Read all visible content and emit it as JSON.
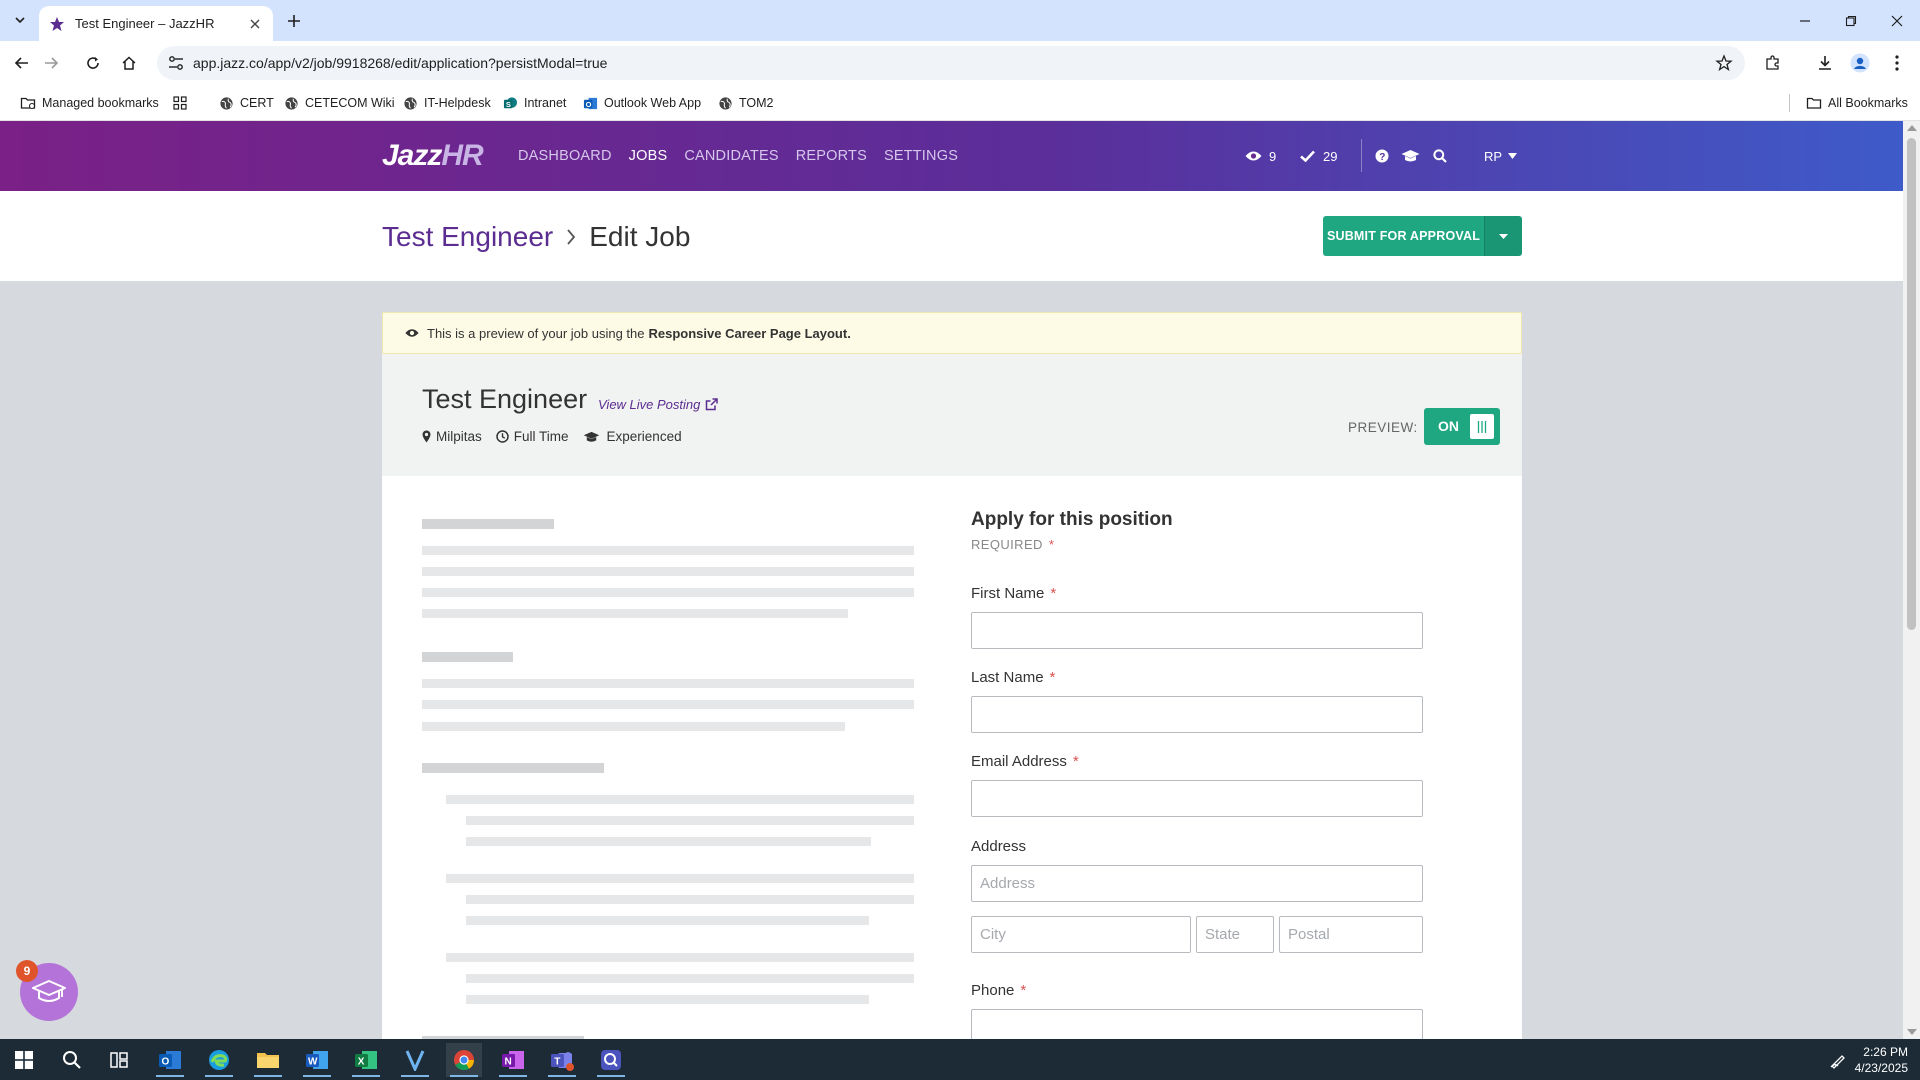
{
  "browser": {
    "tab_title": "Test Engineer – JazzHR",
    "url": "app.jazz.co/app/v2/job/9918268/edit/application?persistModal=true",
    "bookmarks": [
      {
        "label": "Managed bookmarks"
      },
      {
        "label": "CERT"
      },
      {
        "label": "CETECOM Wiki"
      },
      {
        "label": "IT-Helpdesk"
      },
      {
        "label": "Intranet"
      },
      {
        "label": "Outlook Web App"
      },
      {
        "label": "TOM2"
      }
    ],
    "all_bookmarks": "All Bookmarks"
  },
  "app": {
    "logo_main": "Jazz",
    "logo_accent": "HR",
    "nav": [
      {
        "label": "DASHBOARD",
        "active": false
      },
      {
        "label": "JOBS",
        "active": true
      },
      {
        "label": "CANDIDATES",
        "active": false
      },
      {
        "label": "REPORTS",
        "active": false
      },
      {
        "label": "SETTINGS",
        "active": false
      }
    ],
    "views_count": "9",
    "tasks_count": "29",
    "user_initials": "RP",
    "brand_purple": "#5c2d91",
    "accent_green": "#1ea781"
  },
  "header": {
    "breadcrumb_job": "Test Engineer",
    "breadcrumb_current": "Edit Job",
    "submit_label": "SUBMIT FOR APPROVAL"
  },
  "preview": {
    "banner_text": "This is a preview of your job using the",
    "banner_bold": "Responsive Career Page Layout.",
    "job_title": "Test Engineer",
    "view_live": "View Live Posting",
    "location": "Milpitas",
    "type": "Full Time",
    "experience": "Experienced",
    "preview_label": "PREVIEW:",
    "toggle_label": "ON"
  },
  "form": {
    "title": "Apply for this position",
    "required_label": "REQUIRED",
    "first_name_label": "First Name",
    "last_name_label": "Last Name",
    "email_label": "Email Address",
    "address_label": "Address",
    "address_placeholder": "Address",
    "city_placeholder": "City",
    "state_placeholder": "State",
    "postal_placeholder": "Postal",
    "phone_label": "Phone"
  },
  "help_badge_count": "9",
  "taskbar": {
    "time": "2:26 PM",
    "date": "4/23/2025"
  }
}
